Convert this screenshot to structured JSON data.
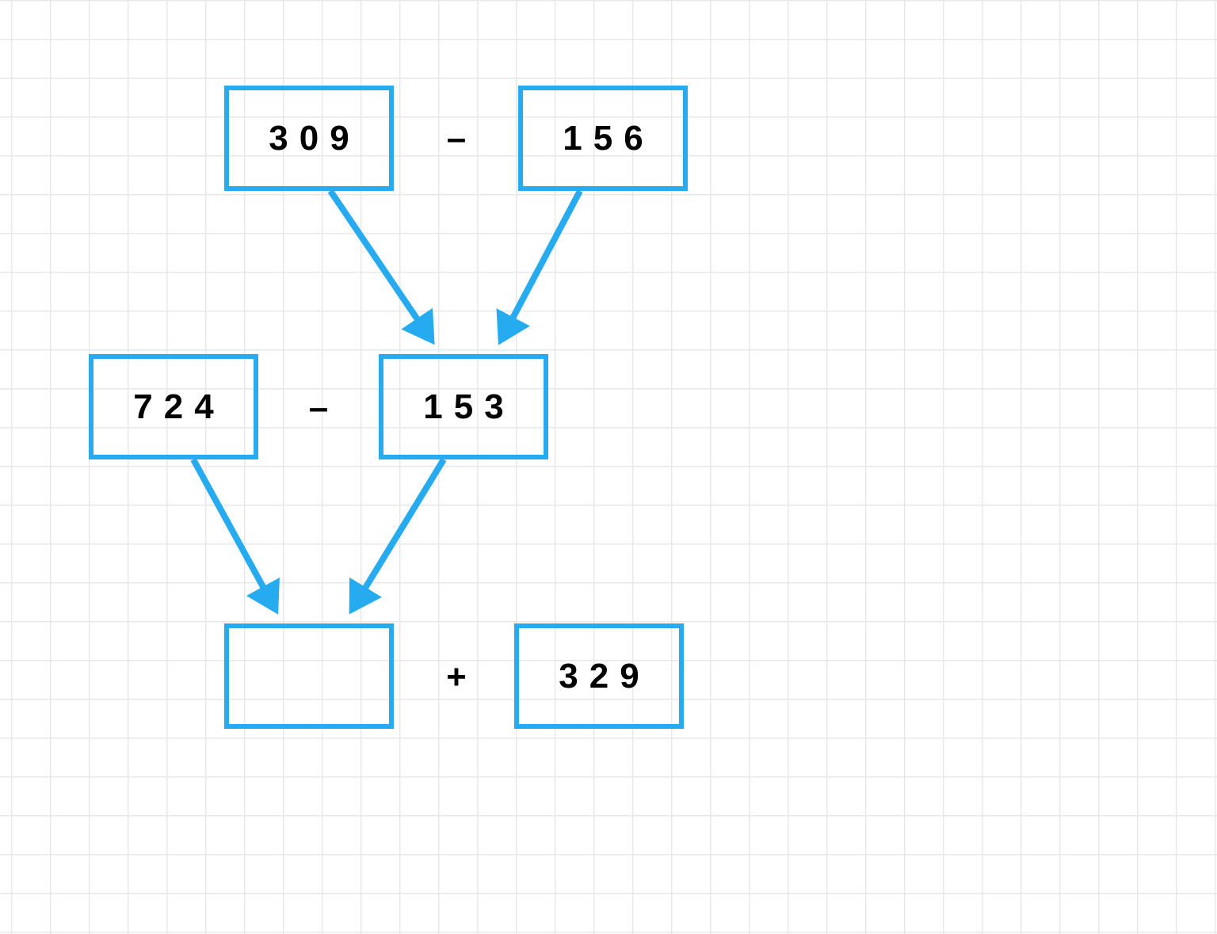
{
  "boxes": {
    "r1_left": "309",
    "r1_right": "156",
    "r2_left": "724",
    "r2_right": "153",
    "r3_left": "",
    "r3_right": "329"
  },
  "ops": {
    "r1": "–",
    "r2": "–",
    "r3": "+"
  },
  "colors": {
    "box_border": "#26aaf0",
    "grid_line": "#e8e8e8"
  }
}
